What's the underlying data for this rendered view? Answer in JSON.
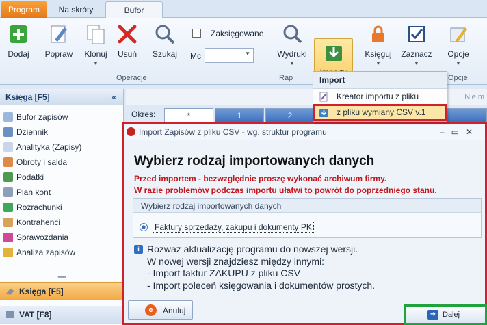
{
  "tabs": [
    {
      "label": "Program"
    },
    {
      "label": "Na skróty"
    },
    {
      "label": "Bufor"
    }
  ],
  "ribbon": {
    "dodaj": "Dodaj",
    "popraw": "Popraw",
    "klonuj": "Klonuj",
    "usun": "Usuń",
    "szukaj": "Szukaj",
    "zaksiegowane": "Zaksięgowane",
    "mc_label": "Mc",
    "wydruki": "Wydruki",
    "importy": "Importy",
    "ksieguj": "Księguj",
    "zaznacz": "Zaznacz",
    "opcje": "Opcje",
    "group_operacje": "Operacje",
    "group_rap": "Rap",
    "group_opcje": "Opcje"
  },
  "menu": {
    "header": "Import",
    "items": [
      {
        "label": "Kreator importu z pliku"
      },
      {
        "label": "z pliku wymiany CSV v.1"
      }
    ]
  },
  "sidebar": {
    "header": "Księga [F5]",
    "collapse": "«",
    "items": [
      {
        "label": "Bufor zapisów"
      },
      {
        "label": "Dziennik"
      },
      {
        "label": "Analityka (Zapisy)"
      },
      {
        "label": "Obroty i salda"
      },
      {
        "label": "Podatki"
      },
      {
        "label": "Plan kont"
      },
      {
        "label": "Rozrachunki"
      },
      {
        "label": "Kontrahenci"
      },
      {
        "label": "Sprawozdania"
      },
      {
        "label": "Analiza zapisów"
      }
    ],
    "grip": "••••",
    "sections": [
      {
        "label": "Księga [F5]"
      },
      {
        "label": "VAT [F8]"
      }
    ]
  },
  "content": {
    "nie_m": "Nie m",
    "okres_label": "Okres:",
    "okres_tabs": [
      "*",
      "1",
      "2"
    ]
  },
  "dialog": {
    "title": "Import Zapisów z pliku CSV - wg. struktur programu",
    "heading": "Wybierz rodzaj importowanych danych",
    "warning1": "Przed importem - bezwzględnie proszę wykonać archiwum firmy.",
    "warning2": "W razie problemów podczas importu ułatwi to powrót do poprzedniego stanu.",
    "group_label": "Wybierz rodzaj importowanych danych",
    "option": "Faktury sprzedaży, zakupu i dokumenty PK",
    "info_lines": [
      "Rozważ aktualizację programu do nowszej wersji.",
      "W nowej wersji znajdziesz między innymi:",
      "- Import faktur ZAKUPU z pliku CSV",
      "- Import poleceń księgowania i dokumentów prostych."
    ],
    "cancel": "Anuluj",
    "next": "Dalej"
  },
  "colors": {
    "accent_red": "#d0202e",
    "accent_green": "#1fa33a",
    "program_tab": "#e6781a",
    "highlight": "#f9cc5c"
  }
}
